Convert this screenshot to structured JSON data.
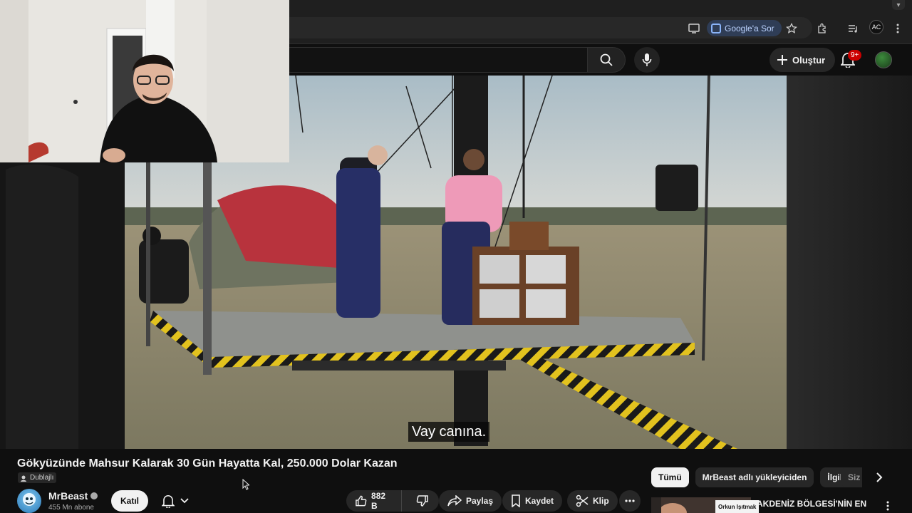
{
  "browser": {
    "google_sor_label": "Google'a Sor",
    "profile_initials": "AC"
  },
  "masthead": {
    "create_label": "Oluştur",
    "notification_badge": "9+"
  },
  "player": {
    "caption": "Vay canına."
  },
  "video": {
    "title": "Gökyüzünde Mahsur Kalarak 30 Gün Hayatta Kal, 250.000 Dolar Kazan",
    "dub_badge": "Dublajlı",
    "channel_name": "MrBeast",
    "subscribers": "455 Mn abone",
    "join_label": "Katıl",
    "like_count": "882 B",
    "share_label": "Paylaş",
    "save_label": "Kaydet",
    "clip_label": "Klip"
  },
  "chips": {
    "items": [
      "Tümü",
      "MrBeast adlı yükleyiciden",
      "İlgili"
    ],
    "partial": "Siz"
  },
  "recommendation": {
    "channel_tag": "Orkun Işıtmak",
    "title": "AKDENİZ BÖLGESİ'NİN EN"
  },
  "colors": {
    "accent": "#3ea6ff",
    "badge": "#cc0000",
    "background": "#0f0f0f"
  }
}
